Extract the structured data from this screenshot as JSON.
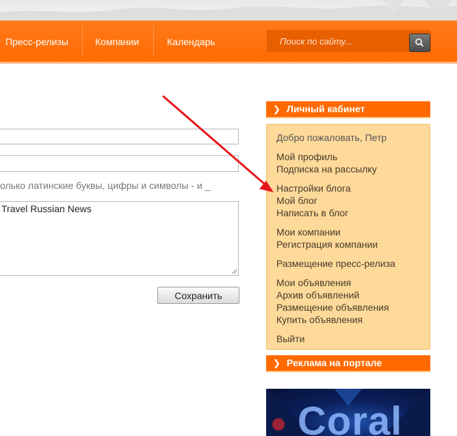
{
  "nav": {
    "items": [
      "Пресс-релизы",
      "Компании",
      "Календарь"
    ],
    "search_placeholder": "Поиск по сайту..."
  },
  "form": {
    "hint": "олько латинские буквы, цифры и символы - и _",
    "description_value": "Travel Russian News",
    "save_label": "Сохранить"
  },
  "sidebar": {
    "cabinet_title": "Личный кабинет",
    "welcome": "Добро пожаловать, Петр",
    "links": [
      "Мой профиль",
      "Подписка на рассылку",
      "Настройки блога",
      "Мой блог",
      "Написать в блог",
      "Мои компании",
      "Регистрация компании",
      "Размещение пресс-релиза",
      "Мои объявления",
      "Архив объявлений",
      "Размещение объявления",
      "Купить объявления",
      "Выйти"
    ],
    "ads_title": "Реклама на портале"
  },
  "banner": {
    "text": "Coral"
  },
  "colors": {
    "accent": "#ff6a00",
    "sidebar_bg": "#fdd99a",
    "arrow": "#e8161b"
  },
  "icons": {
    "search": "magnifier-icon",
    "chevron": "chevron-right-icon"
  }
}
